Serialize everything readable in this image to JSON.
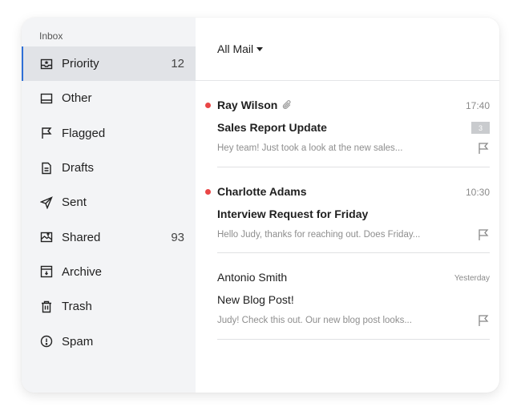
{
  "sidebar": {
    "section_label": "Inbox",
    "items": [
      {
        "label": "Priority",
        "count": "12",
        "icon": "priority-inbox-icon"
      },
      {
        "label": "Other",
        "count": "",
        "icon": "tray-icon"
      },
      {
        "label": "Flagged",
        "count": "",
        "icon": "flag-icon"
      },
      {
        "label": "Drafts",
        "count": "",
        "icon": "draft-icon"
      },
      {
        "label": "Sent",
        "count": "",
        "icon": "send-icon"
      },
      {
        "label": "Shared",
        "count": "93",
        "icon": "shared-icon"
      },
      {
        "label": "Archive",
        "count": "",
        "icon": "archive-icon"
      },
      {
        "label": "Trash",
        "count": "",
        "icon": "trash-icon"
      },
      {
        "label": "Spam",
        "count": "",
        "icon": "spam-icon"
      }
    ]
  },
  "main": {
    "folder_label": "All Mail",
    "messages": [
      {
        "sender": "Ray Wilson",
        "time": "17:40",
        "subject": "Sales Report Update",
        "badge": "3",
        "preview": "Hey team! Just took a look at the new sales...",
        "unread": true,
        "attachment": true
      },
      {
        "sender": "Charlotte Adams",
        "time": "10:30",
        "subject": "Interview Request for Friday",
        "badge": "",
        "preview": "Hello Judy, thanks for reaching out. Does Friday...",
        "unread": true,
        "attachment": false
      },
      {
        "sender": "Antonio Smith",
        "time": "Yesterday",
        "subject": "New Blog Post!",
        "badge": "",
        "preview": "Judy! Check this out. Our new blog post looks...",
        "unread": false,
        "attachment": false
      }
    ]
  },
  "colors": {
    "accent": "#2f6fd6",
    "unread_dot": "#e94646",
    "sidebar_bg": "#f3f4f6",
    "active_bg": "#e1e3e7"
  }
}
